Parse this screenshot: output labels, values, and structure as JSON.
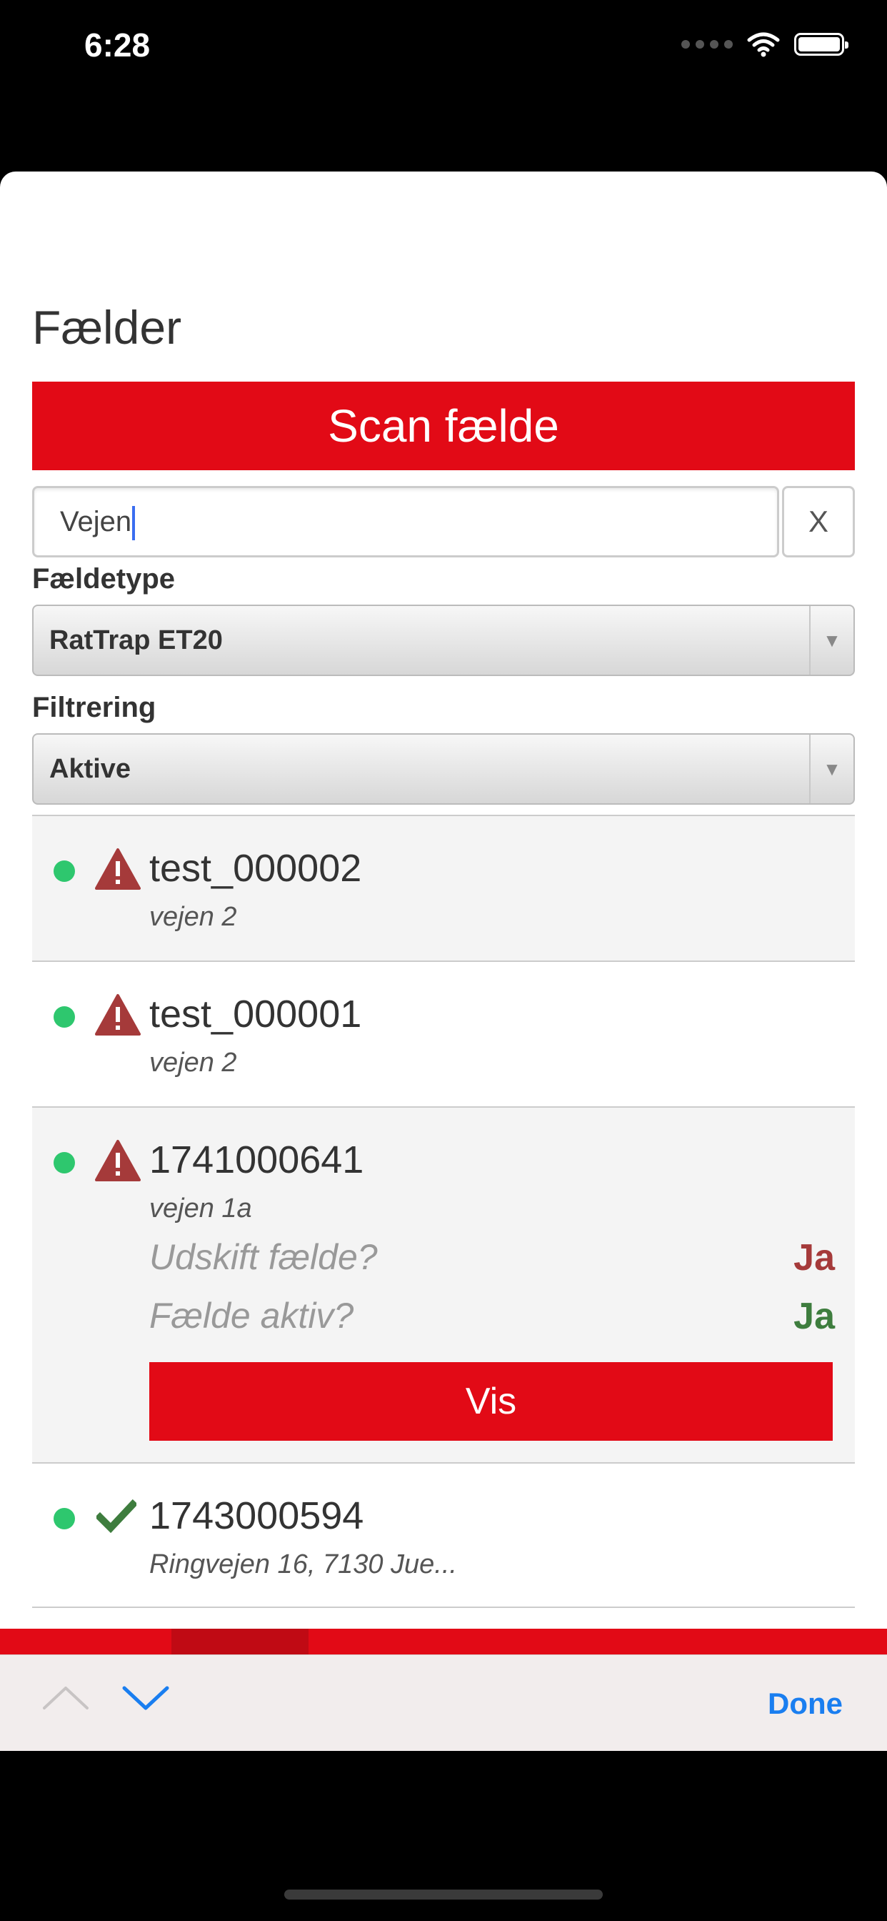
{
  "status_bar": {
    "time": "6:28"
  },
  "page": {
    "title": "Fælder"
  },
  "scan_button": {
    "label": "Scan fælde"
  },
  "search": {
    "value": "Vejen",
    "clear_label": "X"
  },
  "trap_type": {
    "label": "Fældetype",
    "selected": "RatTrap ET20"
  },
  "filter": {
    "label": "Filtrering",
    "selected": "Aktive"
  },
  "traps": [
    {
      "id": "test_000002",
      "address": "vejen 2",
      "status_color": "#2ec76e",
      "icon": "warning-icon"
    },
    {
      "id": "test_000001",
      "address": "vejen 2",
      "status_color": "#2ec76e",
      "icon": "warning-icon"
    },
    {
      "id": "1741000641",
      "address": "vejen 1a",
      "status_color": "#2ec76e",
      "icon": "warning-icon",
      "details": [
        {
          "question": "Udskift fælde?",
          "answer": "Ja",
          "answer_color": "#a53a3a"
        },
        {
          "question": "Fælde aktiv?",
          "answer": "Ja",
          "answer_color": "#3e7d3e"
        }
      ],
      "action_label": "Vis"
    },
    {
      "id": "1743000594",
      "address": "Ringvejen 16, 7130 Jue...",
      "status_color": "#2ec76e",
      "icon": "checkmark-icon"
    }
  ],
  "keyboard_toolbar": {
    "done_label": "Done"
  },
  "colors": {
    "brand_red": "#e20a16",
    "status_green": "#2ec76e",
    "warning_red": "#a53a3a",
    "ok_green": "#3e7d3e",
    "ios_blue": "#1a7ef0"
  }
}
